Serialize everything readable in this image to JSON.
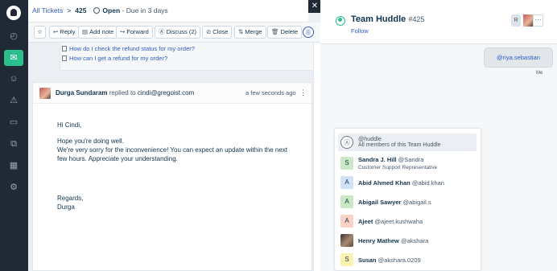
{
  "nav": {
    "items": [
      "dashboard-icon",
      "tickets-icon",
      "contacts-icon",
      "alerts-icon",
      "book-icon",
      "copy-icon",
      "reports-icon",
      "settings-icon"
    ],
    "glyphs": [
      "◴",
      "✉",
      "☺",
      "⚠",
      "▭",
      "⧉",
      "▦",
      "⚙"
    ]
  },
  "header": {
    "all_tickets": "All Tickets",
    "separator": ">",
    "ticket_id": "425",
    "status": "Open",
    "due": " - Due in 3 days"
  },
  "toolbar": {
    "star": "☆",
    "reply": "Reply",
    "add_note": "Add note",
    "forward": "Forward",
    "discuss": "Discuss (2)",
    "close": "Close",
    "merge": "Merge",
    "delete": "Delete"
  },
  "kb_links": [
    "How do I check the refund status for my order?",
    "How can I get a refund for my order?"
  ],
  "message": {
    "sender": "Durga Sundaram",
    "replied_to": "replied to",
    "recipient": "cindi@gregoist.com",
    "time": "a few seconds ago",
    "lines": [
      "Hi Cindi,",
      "Hope you're doing well.",
      "We're very sorry for the inconvenience! You can expect an update within the next",
      "few hours. Appreciate your understanding.",
      "Regards,",
      "Durga"
    ]
  },
  "panel": {
    "team_name": "Team Huddle",
    "team_id": "#425",
    "follow": "Follow",
    "r_badge": "R",
    "more": "···",
    "bubble": "@riya.sebastian",
    "me": "Me",
    "mentions": [
      {
        "avatar": "",
        "name": "@huddle",
        "sub": "All members of this Team Huddle",
        "color": "#ffffff"
      },
      {
        "avatar": "S",
        "name": "Sandra J. Hill",
        "handle": "@Sandra",
        "sub": "Customer Support Representative",
        "color": "#c9e8c4"
      },
      {
        "avatar": "A",
        "name": "Abid Ahmed Khan",
        "handle": "@abid.khan",
        "color": "#cfe2f8"
      },
      {
        "avatar": "A",
        "name": "Abigail Sawyer",
        "handle": "@abigail.s",
        "color": "#c9e8c4"
      },
      {
        "avatar": "A",
        "name": "Ajeet",
        "handle": "@ajeet.kushwaha",
        "color": "#f9d4c4"
      },
      {
        "avatar": "",
        "name": "Henry Mathew",
        "handle": "@akshara",
        "color": "#5c4a44"
      },
      {
        "avatar": "S",
        "name": "Susan",
        "handle": "@akshara.0209",
        "color": "#fbf1b0"
      }
    ]
  },
  "colors": {
    "rail": "#1f2a36",
    "accent": "#2bbf8e",
    "link": "#2c5cc5"
  }
}
